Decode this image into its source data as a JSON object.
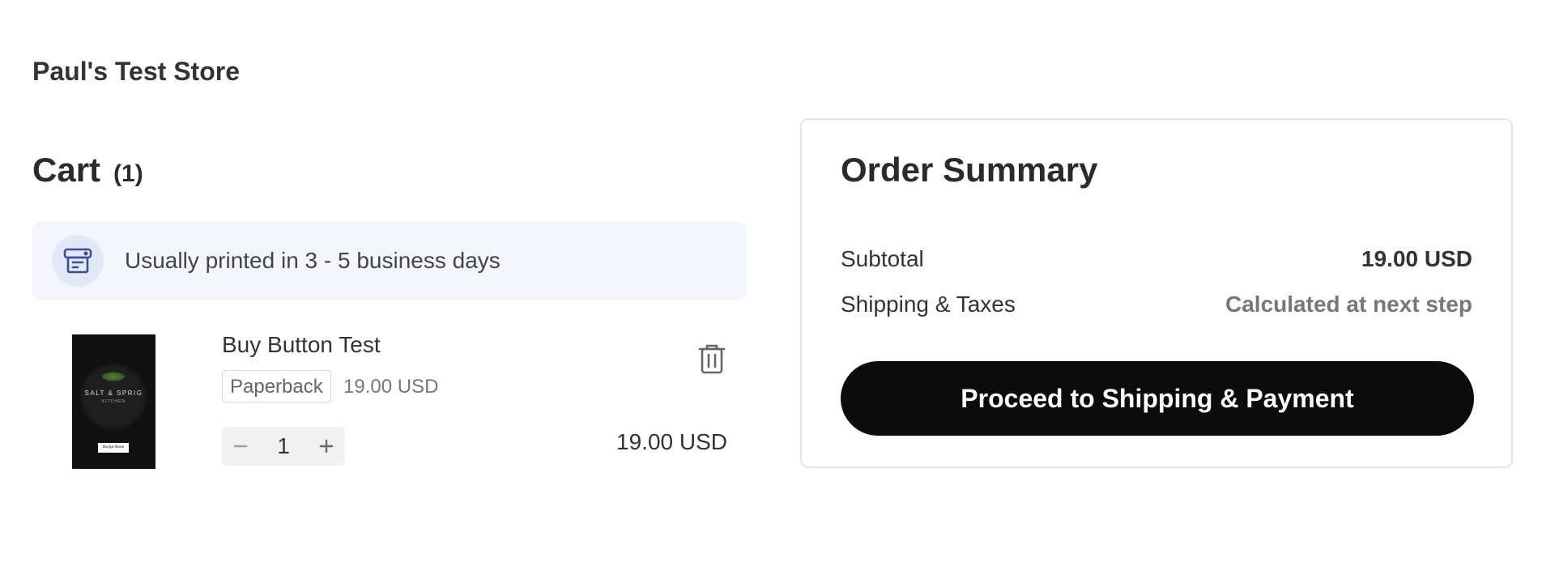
{
  "store": {
    "name": "Paul's Test Store"
  },
  "cart": {
    "title": "Cart",
    "count": "(1)",
    "banner": {
      "icon": "printer-icon",
      "text": "Usually printed in 3 - 5 business days"
    },
    "items": [
      {
        "name": "Buy Button Test",
        "format": "Paperback",
        "unit_price": "19.00 USD",
        "quantity": "1",
        "line_total": "19.00 USD",
        "cover": {
          "brand": "SALT & SPRIG",
          "sub": "KITCHEN",
          "label": "Recipe Book"
        },
        "decrement_icon": "minus-icon",
        "increment_icon": "plus-icon",
        "remove_icon": "trash-icon"
      }
    ]
  },
  "summary": {
    "title": "Order Summary",
    "subtotal_label": "Subtotal",
    "subtotal_value": "19.00 USD",
    "shipping_label": "Shipping & Taxes",
    "shipping_value": "Calculated at next step",
    "checkout_label": "Proceed to Shipping & Payment"
  },
  "colors": {
    "banner_bg": "#f3f6fd",
    "icon_accent": "#3b4f8c",
    "button_bg": "#0b0b0b",
    "muted_text": "#777777"
  }
}
